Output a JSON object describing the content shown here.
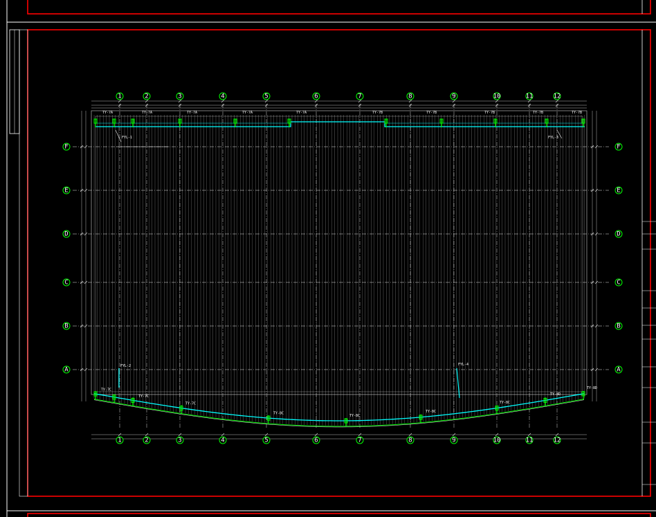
{
  "drawing": {
    "columns": [
      "1",
      "2",
      "3",
      "4",
      "5",
      "6",
      "7",
      "8",
      "9",
      "10",
      "11",
      "12"
    ],
    "rows": [
      "F",
      "E",
      "D",
      "C",
      "B",
      "A"
    ],
    "colors": {
      "background": "#000000",
      "frame": "#ff0000",
      "grid": "#9a9a9a",
      "panel": "#ffffff",
      "gutter": "#00ffff",
      "slope": "#00ff00",
      "bubble": "#00ff00"
    },
    "top_gutter_tags": [
      "TY-7A",
      "TY-7A",
      "TY-7A",
      "TY-7A",
      "TY-7A",
      "TY-7B",
      "TY-7B",
      "TY-7B",
      "TY-7B",
      "TY-7B"
    ],
    "bottom_gutter_tags": [
      "TY-7C",
      "TY-7C",
      "TY-7C",
      "TY-8C",
      "TY-8C",
      "TY-8C",
      "TY-8C",
      "TY-8D",
      "TY-8D"
    ],
    "callouts": [
      "FYL-1",
      "FYL-2",
      "FYL-3",
      "FYL-4"
    ]
  }
}
